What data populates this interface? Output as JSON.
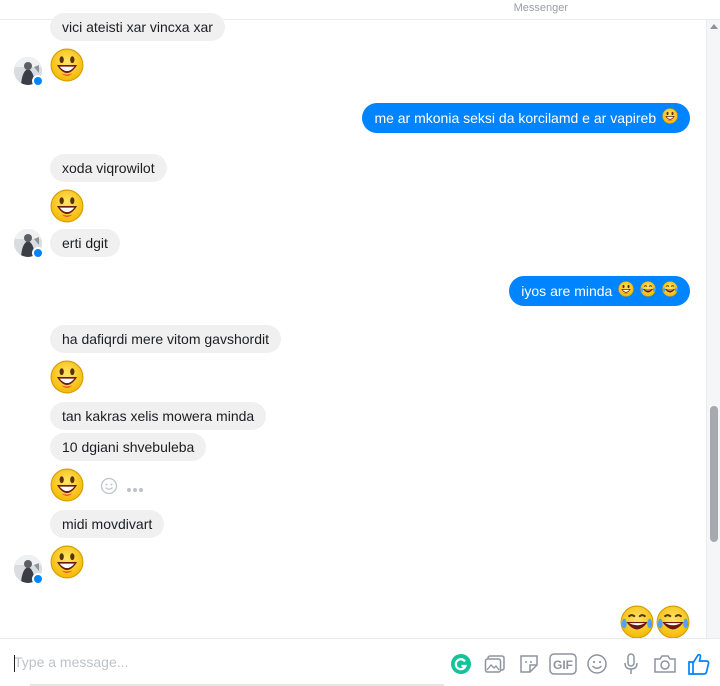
{
  "header": {
    "app_label": "Messenger"
  },
  "messages": {
    "m1": "vici ateisti xar vincxa xar",
    "m2": "me ar mkonia seksi da korcilamd e ar vapireb",
    "m3": "xoda viqrowilot",
    "m4": "erti dgit",
    "m5": "iyos are minda",
    "m6": "ha dafiqrdi mere vitom gavshordit",
    "m7": "tan kakras xelis mowera minda",
    "m8": "10 dgiani shvebuleba",
    "m9": "midi movdivart"
  },
  "composer": {
    "placeholder": "Type a message...",
    "gif_label": "GIF"
  },
  "icons": {
    "smile_emoji": "grinning-face-emoji",
    "laugh_emoji": "tears-of-joy-emoji",
    "like": "thumbs-up-icon"
  },
  "colors": {
    "outgoing_bubble": "#0084ff",
    "incoming_bubble": "#f1f0f0",
    "accent": "#0084ff",
    "grammarly": "#15c39a"
  }
}
